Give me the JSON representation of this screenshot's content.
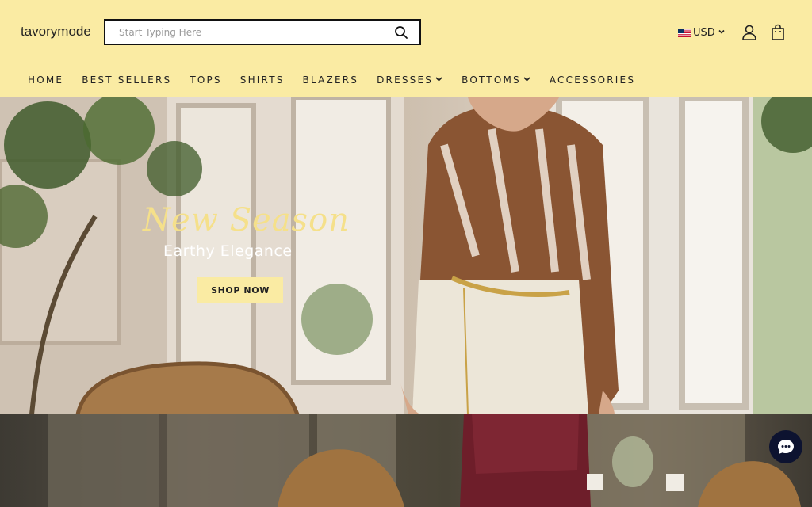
{
  "brand": {
    "name": "tavorymode"
  },
  "search": {
    "placeholder": "Start Typing Here"
  },
  "currency": {
    "code": "USD"
  },
  "nav": {
    "items": [
      {
        "label": "HOME",
        "has_dropdown": false
      },
      {
        "label": "BEST SELLERS",
        "has_dropdown": false
      },
      {
        "label": "TOPS",
        "has_dropdown": false
      },
      {
        "label": "SHIRTS",
        "has_dropdown": false
      },
      {
        "label": "BLAZERS",
        "has_dropdown": false
      },
      {
        "label": "DRESSES",
        "has_dropdown": true
      },
      {
        "label": "BOTTOMS",
        "has_dropdown": true
      },
      {
        "label": "ACCESSORIES",
        "has_dropdown": false
      }
    ]
  },
  "hero": {
    "title": "New Season",
    "subtitle": "Earthy Elegance",
    "cta": "SHOP NOW"
  },
  "icons": {
    "search": "search-icon",
    "account": "user-icon",
    "cart": "shopping-bag-icon",
    "chat": "chat-icon"
  },
  "colors": {
    "header_bg": "#faeba3",
    "hero_title": "#f5e08a",
    "chat_bg": "#0d1330"
  }
}
